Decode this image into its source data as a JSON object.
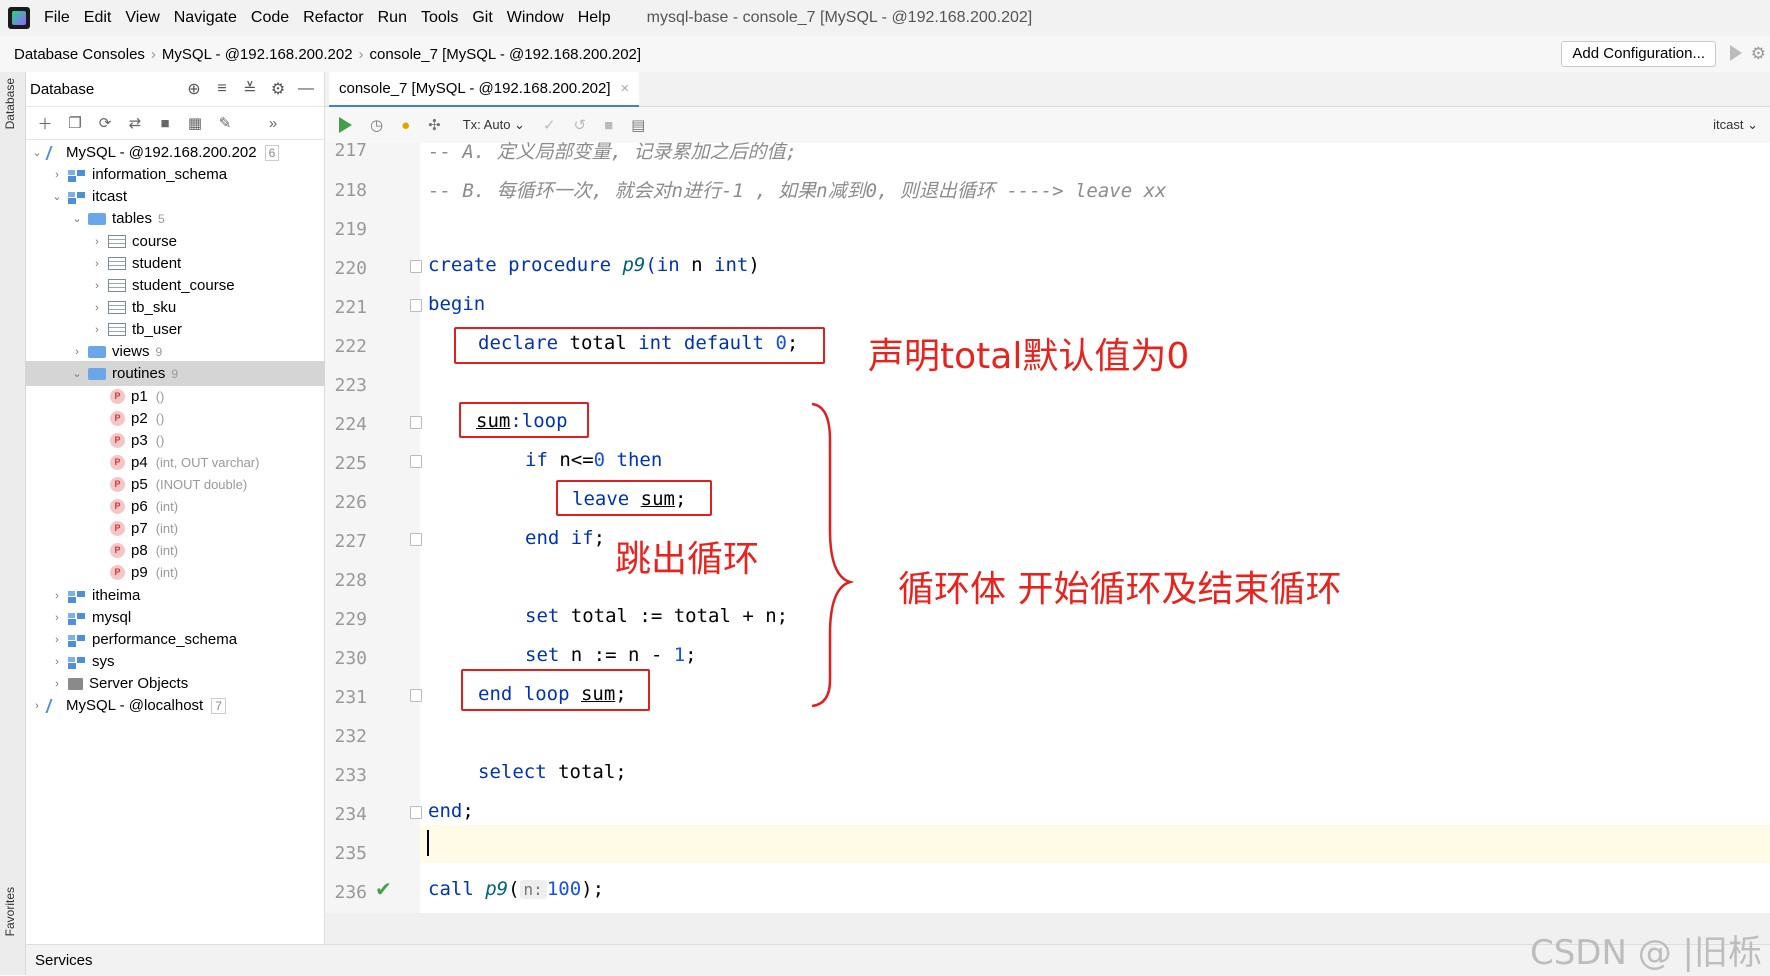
{
  "menubar": {
    "items": [
      "File",
      "Edit",
      "View",
      "Navigate",
      "Code",
      "Refactor",
      "Run",
      "Tools",
      "Git",
      "Window",
      "Help"
    ],
    "window_title": "mysql-base - console_7 [MySQL - @192.168.200.202]"
  },
  "navbar": {
    "crumbs": [
      "Database Consoles",
      "MySQL - @192.168.200.202",
      "console_7 [MySQL - @192.168.200.202]"
    ],
    "add_configuration": "Add Configuration..."
  },
  "stripe": {
    "top_label": "Database",
    "bottom_label": "Favorites"
  },
  "db_panel": {
    "title": "Database",
    "tree": [
      {
        "label": "MySQL - @192.168.200.202",
        "badge": "6"
      },
      {
        "label": "information_schema"
      },
      {
        "label": "itcast"
      },
      {
        "label": "tables",
        "count": "5"
      },
      {
        "label": "course"
      },
      {
        "label": "student"
      },
      {
        "label": "student_course"
      },
      {
        "label": "tb_sku"
      },
      {
        "label": "tb_user"
      },
      {
        "label": "views",
        "count": "9"
      },
      {
        "label": "routines",
        "count": "9"
      },
      {
        "label": "p1",
        "sig": "()"
      },
      {
        "label": "p2",
        "sig": "()"
      },
      {
        "label": "p3",
        "sig": "()"
      },
      {
        "label": "p4",
        "sig": "(int, OUT varchar)"
      },
      {
        "label": "p5",
        "sig": "(INOUT double)"
      },
      {
        "label": "p6",
        "sig": "(int)"
      },
      {
        "label": "p7",
        "sig": "(int)"
      },
      {
        "label": "p8",
        "sig": "(int)"
      },
      {
        "label": "p9",
        "sig": "(int)"
      },
      {
        "label": "itheima"
      },
      {
        "label": "mysql"
      },
      {
        "label": "performance_schema"
      },
      {
        "label": "sys"
      },
      {
        "label": "Server Objects"
      },
      {
        "label": "MySQL - @localhost",
        "badge": "7"
      }
    ]
  },
  "editor": {
    "tab_label": "console_7 [MySQL - @192.168.200.202]",
    "tx_mode": "Tx: Auto",
    "schema": "itcast",
    "line_numbers": [
      "217",
      "218",
      "219",
      "220",
      "221",
      "222",
      "223",
      "224",
      "225",
      "226",
      "227",
      "228",
      "229",
      "230",
      "231",
      "232",
      "233",
      "234",
      "235",
      "236"
    ],
    "code": {
      "l217": "-- A. 定义局部变量, 记录累加之后的值;",
      "l218": "-- B. 每循环一次, 就会对n进行-1 , 如果n减到0, 则退出循环 ----> leave xx",
      "l220_a": "create procedure ",
      "l220_b": "p9",
      "l220_c": "(in",
      "l220_d": " n ",
      "l220_e": "int",
      "l220_f": ")",
      "l221": "begin",
      "l222_a": "declare",
      "l222_b": " total ",
      "l222_c": "int default",
      "l222_d": " 0",
      "l222_e": ";",
      "l224_a": "sum",
      "l224_b": ":loop",
      "l225_a": "if",
      "l225_b": " n<=",
      "l225_c": "0",
      "l225_d": " then",
      "l226_a": "leave",
      "l226_b": "sum",
      "l226_c": ";",
      "l227_a": "end if",
      "l227_b": ";",
      "l229_a": "set",
      "l229_b": " total := total + n;",
      "l230_a": "set",
      "l230_b": " n := n - ",
      "l230_c": "1",
      "l230_d": ";",
      "l231_a": "end loop",
      "l231_b": "sum",
      "l231_c": ";",
      "l233_a": "select",
      "l233_b": " total;",
      "l234_a": "end",
      "l234_b": ";",
      "l236_a": "call ",
      "l236_b": "p9",
      "l236_c": "(",
      "l236_hint": "n:",
      "l236_d": "100",
      "l236_e": ");"
    }
  },
  "annotations": {
    "declare_note": "声明total默认值为0",
    "leave_note": "跳出循环",
    "loop_note": "循环体  开始循环及结束循环"
  },
  "bottom": {
    "services": "Services",
    "watermark": "CSDN @ |旧栎"
  }
}
